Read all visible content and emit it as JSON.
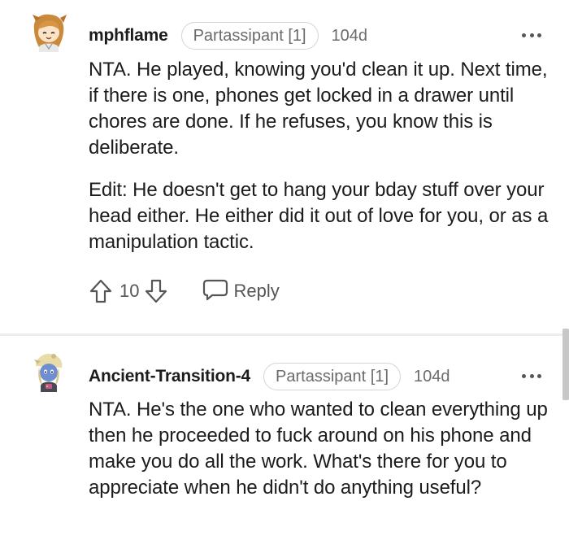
{
  "comments": [
    {
      "username": "mphflame",
      "flair": "Partassipant [1]",
      "age": "104d",
      "paragraphs": [
        "NTA. He played, knowing you'd clean it up. Next time, if there is one, phones get locked in a drawer until chores are done. If he refuses, you know this is deliberate.",
        "Edit: He doesn't get to hang your bday stuff over your head either. He either did it out of love for you, or as a manipulation tactic."
      ],
      "vote_count": "10",
      "reply_label": "Reply"
    },
    {
      "username": "Ancient-Transition-4",
      "flair": "Partassipant [1]",
      "age": "104d",
      "paragraphs": [
        "NTA. He's the one who wanted to clean everything up then he proceeded to fuck around on his phone and make you do all the work. What's there for you to appreciate when he didn't do anything useful?"
      ]
    }
  ],
  "icons": {
    "upvote": "arrow-up-outline-icon",
    "downvote": "arrow-down-outline-icon",
    "reply": "speech-bubble-icon",
    "more": "ellipsis-horizontal-icon"
  },
  "colors": {
    "text": "#1c1c1c",
    "secondary_text": "#6b6b6b",
    "icon": "#555555",
    "divider": "#ededed",
    "flair_border": "#d4d4d4",
    "scrollbar": "#c7c7c7"
  }
}
